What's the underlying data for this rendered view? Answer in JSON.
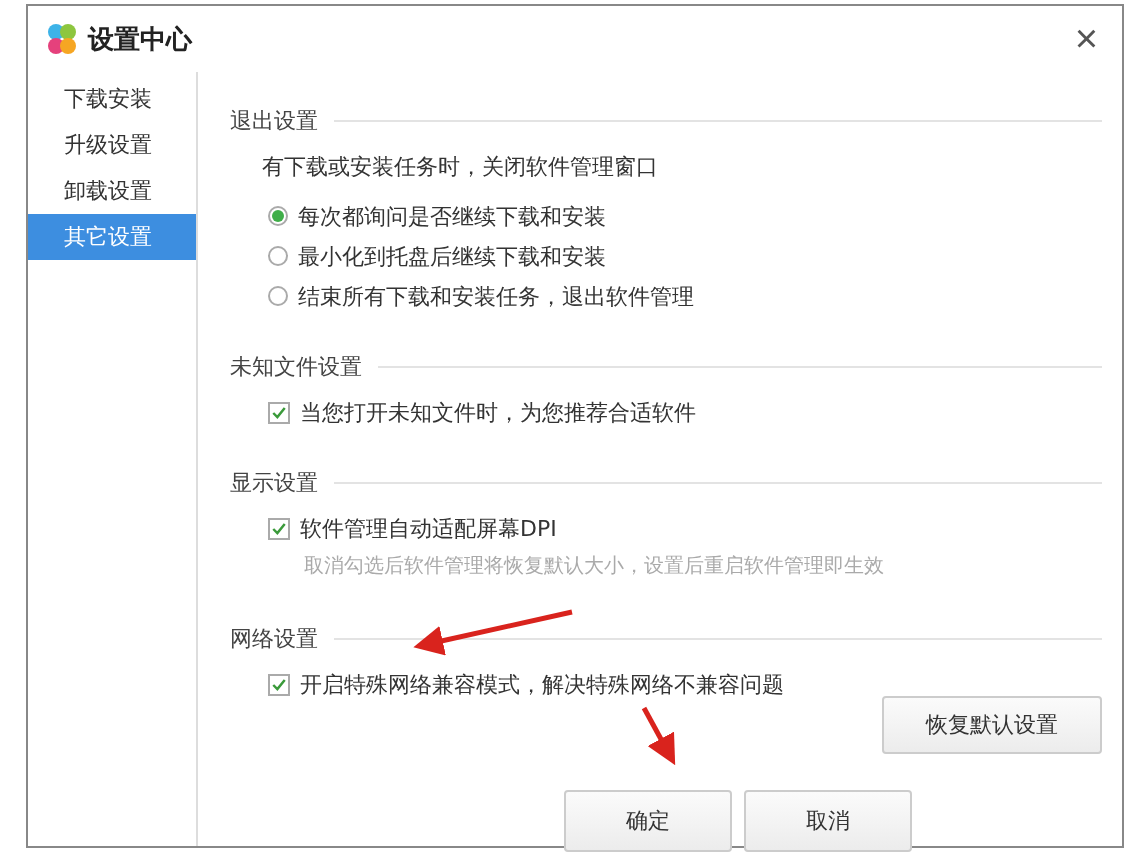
{
  "window": {
    "title": "设置中心",
    "close": "×"
  },
  "sidebar": {
    "items": [
      {
        "label": "下载安装",
        "selected": false
      },
      {
        "label": "升级设置",
        "selected": false
      },
      {
        "label": "卸载设置",
        "selected": false
      },
      {
        "label": "其它设置",
        "selected": true
      }
    ]
  },
  "sections": [
    {
      "title": "退出设置",
      "note": "有下载或安装任务时，关闭软件管理窗口",
      "options": [
        {
          "kind": "radio",
          "label": "每次都询问是否继续下载和安装",
          "selected": true
        },
        {
          "kind": "radio",
          "label": "最小化到托盘后继续下载和安装",
          "selected": false
        },
        {
          "kind": "radio",
          "label": "结束所有下载和安装任务，退出软件管理",
          "selected": false
        }
      ]
    },
    {
      "title": "未知文件设置",
      "options": [
        {
          "kind": "checkbox",
          "label": "当您打开未知文件时，为您推荐合适软件",
          "checked": true
        }
      ]
    },
    {
      "title": "显示设置",
      "options": [
        {
          "kind": "checkbox",
          "label": "软件管理自动适配屏幕DPI",
          "checked": true,
          "hint": "取消勾选后软件管理将恢复默认大小，设置后重启软件管理即生效"
        }
      ]
    },
    {
      "title": "网络设置",
      "options": [
        {
          "kind": "checkbox",
          "label": "开启特殊网络兼容模式，解决特殊网络不兼容问题",
          "checked": true
        }
      ]
    }
  ],
  "restore_button": "恢复默认设置",
  "buttons": [
    "确定",
    "取消"
  ]
}
